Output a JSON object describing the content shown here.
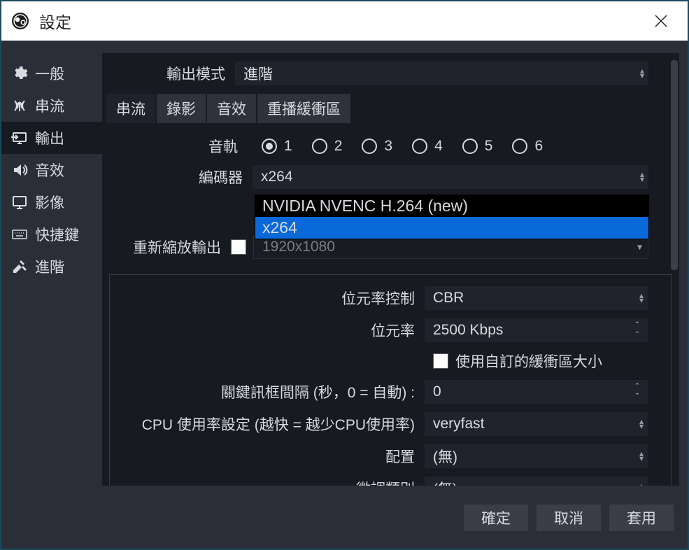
{
  "window": {
    "title": "設定"
  },
  "sidebar": {
    "items": [
      {
        "label": "一般",
        "icon": "gear"
      },
      {
        "label": "串流",
        "icon": "antenna"
      },
      {
        "label": "輸出",
        "icon": "monitor-arrow",
        "selected": true
      },
      {
        "label": "音效",
        "icon": "speaker"
      },
      {
        "label": "影像",
        "icon": "monitor"
      },
      {
        "label": "快捷鍵",
        "icon": "keyboard"
      },
      {
        "label": "進階",
        "icon": "tools"
      }
    ]
  },
  "output": {
    "mode_label": "輸出模式",
    "mode_value": "進階",
    "tabs": [
      "串流",
      "錄影",
      "音效",
      "重播緩衝區"
    ],
    "active_tab": 0,
    "audio_track_label": "音軌",
    "audio_track_values": [
      "1",
      "2",
      "3",
      "4",
      "5",
      "6"
    ],
    "audio_track_selected": 0,
    "encoder_label": "編碼器",
    "encoder_value": "x264",
    "encoder_options": [
      "NVIDIA NVENC H.264 (new)",
      "x264"
    ],
    "encoder_highlight_index": 1,
    "rescale_label": "重新縮放輸出",
    "rescale_value": "1920x1080",
    "rescale_checked": false,
    "rate_control_label": "位元率控制",
    "rate_control_value": "CBR",
    "bitrate_label": "位元率",
    "bitrate_value": "2500 Kbps",
    "custom_buffer_label": "使用自訂的緩衝區大小",
    "custom_buffer_checked": false,
    "keyframe_label": "關鍵訊框間隔 (秒，0 = 自動) :",
    "keyframe_value": "0",
    "cpu_label": "CPU 使用率設定 (越快 = 越少CPU使用率)",
    "cpu_value": "veryfast",
    "profile_label": "配置",
    "profile_value": "(無)",
    "tune_label": "微調類別",
    "tune_value": "(無)"
  },
  "footer": {
    "ok": "確定",
    "cancel": "取消",
    "apply": "套用"
  }
}
